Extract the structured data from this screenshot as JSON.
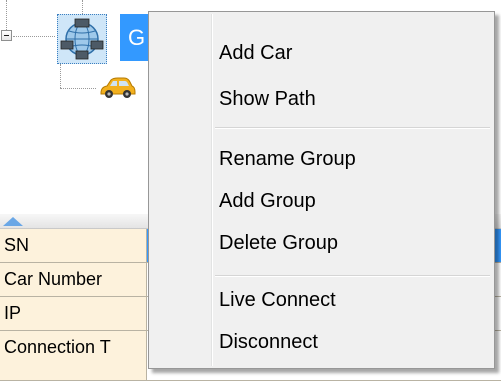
{
  "tree": {
    "group_label": "G",
    "group_icon": "globe-network-icon",
    "child_icon": "car-icon"
  },
  "grid": {
    "sort_icon": "sort-ascending-icon",
    "rows": [
      {
        "label": "SN"
      },
      {
        "label": "Car Number"
      },
      {
        "label": "IP"
      },
      {
        "label": "Connection T"
      }
    ]
  },
  "context_menu": {
    "items": [
      {
        "label": "Add Car"
      },
      {
        "label": "Show Path"
      },
      {
        "label": "Rename Group"
      },
      {
        "label": "Add Group"
      },
      {
        "label": "Delete Group"
      },
      {
        "label": "Live Connect"
      },
      {
        "label": "Disconnect"
      }
    ]
  },
  "colors": {
    "selection": "#3399ff",
    "menu_background": "#f0f0f0",
    "grid_label_background": "#fdf2dc"
  }
}
